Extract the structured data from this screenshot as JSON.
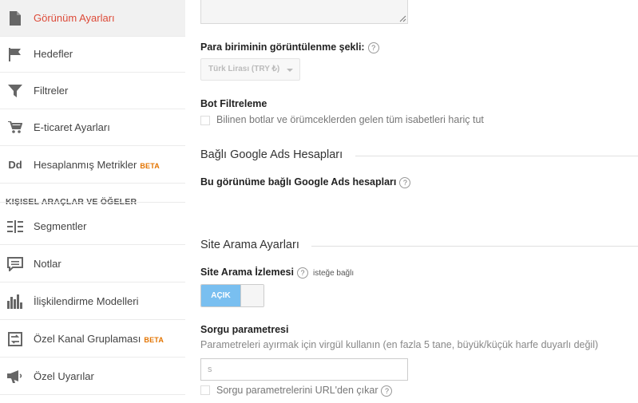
{
  "sidebar": {
    "items": [
      {
        "label": "Görünüm Ayarları",
        "icon": "document-icon",
        "active": true
      },
      {
        "label": "Hedefler",
        "icon": "flag-icon"
      },
      {
        "label": "Filtreler",
        "icon": "funnel-icon"
      },
      {
        "label": "E-ticaret Ayarları",
        "icon": "cart-icon"
      },
      {
        "label": "Hesaplanmış Metrikler",
        "icon": "dd-icon",
        "badge": "BETA"
      }
    ],
    "section_header": "KIŞISEL ARAÇLAR VE ÖĞELER",
    "tools": [
      {
        "label": "Segmentler",
        "icon": "segments-icon"
      },
      {
        "label": "Notlar",
        "icon": "notes-icon"
      },
      {
        "label": "İlişkilendirme Modelleri",
        "icon": "bar-chart-icon"
      },
      {
        "label": "Özel Kanal Gruplaması",
        "icon": "channel-grouping-icon",
        "badge": "BETA"
      },
      {
        "label": "Özel Uyarılar",
        "icon": "megaphone-icon"
      }
    ],
    "active_color": "#dd4b39",
    "beta_color": "#e37400"
  },
  "main": {
    "currency": {
      "label": "Para biriminin görüntülenme şekli:",
      "help": "?",
      "selected": "Türk Lirası (TRY ₺)"
    },
    "bot_filter": {
      "label": "Bot Filtreleme",
      "checkbox_label": "Bilinen botlar ve örümceklerden gelen tüm isabetleri hariç tut",
      "checked": false
    },
    "google_ads": {
      "section_title": "Bağlı Google Ads Hesapları",
      "label": "Bu görünüme bağlı Google Ads hesapları",
      "help": "?"
    },
    "site_search": {
      "section_title": "Site Arama Ayarları",
      "tracking_label": "Site Arama İzlemesi",
      "help": "?",
      "optional": "isteğe bağlı",
      "toggle_label": "AÇIK",
      "toggle_color": "#79bff0",
      "query_label": "Sorgu parametresi",
      "query_desc": "Parametreleri ayırmak için virgül kullanın (en fazla 5 tane, büyük/küçük harfe duyarlı değil)",
      "query_value": "s",
      "strip_label": "Sorgu parametrelerini URL'den çıkar",
      "strip_help": "?"
    }
  }
}
